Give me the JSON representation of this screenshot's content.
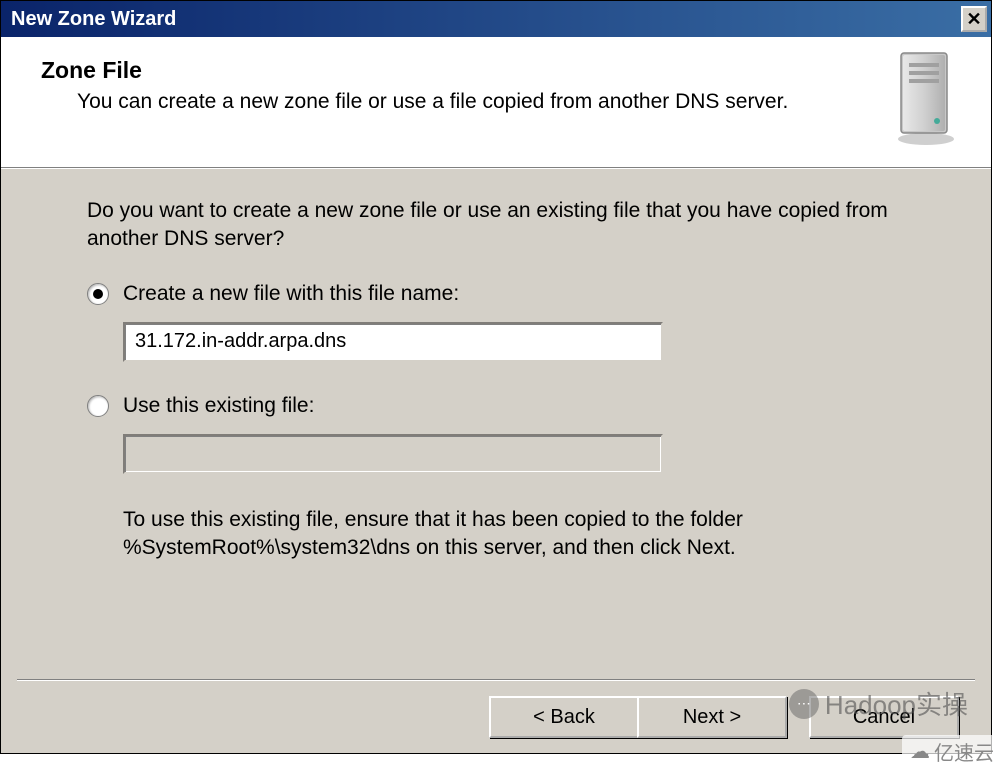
{
  "window": {
    "title": "New Zone Wizard"
  },
  "header": {
    "title": "Zone File",
    "subtitle": "You can create a new zone file or use a file copied from another DNS server."
  },
  "content": {
    "question": "Do you want to create a new zone file or use an existing file that you have copied from another DNS server?",
    "option1_label": "Create a new file with this file name:",
    "option1_value": "31.172.in-addr.arpa.dns",
    "option2_label": "Use this existing file:",
    "option2_value": "",
    "note": "To use this existing file, ensure that it has been copied to the folder %SystemRoot%\\system32\\dns on this server, and then click Next."
  },
  "buttons": {
    "back": "< Back",
    "next": "Next >",
    "cancel": "Cancel"
  },
  "watermarks": {
    "w1": "Hadoop实操",
    "w2": "亿速云"
  }
}
